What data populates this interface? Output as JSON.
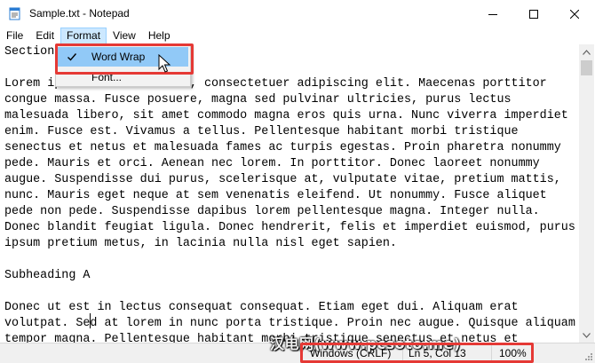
{
  "window": {
    "title": "Sample.txt - Notepad"
  },
  "menubar": {
    "items": [
      {
        "label": "File"
      },
      {
        "label": "Edit"
      },
      {
        "label": "Format",
        "active": true
      },
      {
        "label": "View"
      },
      {
        "label": "Help"
      }
    ]
  },
  "format_menu": {
    "items": [
      {
        "label": "Word Wrap",
        "checked": true
      },
      {
        "label": "Font..."
      }
    ]
  },
  "editor": {
    "lines": [
      "Section",
      "",
      "Lorem ipsum dolor sit amet, consectetuer adipiscing elit. Maecenas porttitor",
      "congue massa. Fusce posuere, magna sed pulvinar ultricies, purus lectus",
      "malesuada libero, sit amet commodo magna eros quis urna. Nunc viverra imperdiet",
      "enim. Fusce est. Vivamus a tellus. Pellentesque habitant morbi tristique",
      "senectus et netus et malesuada fames ac turpis egestas. Proin pharetra nonummy",
      "pede. Mauris et orci. Aenean nec lorem. In porttitor. Donec laoreet nonummy",
      "augue. Suspendisse dui purus, scelerisque at, vulputate vitae, pretium mattis,",
      "nunc. Mauris eget neque at sem venenatis eleifend. Ut nonummy. Fusce aliquet",
      "pede non pede. Suspendisse dapibus lorem pellentesque magna. Integer nulla.",
      "Donec blandit feugiat ligula. Donec hendrerit, felis et imperdiet euismod, purus",
      "ipsum pretium metus, in lacinia nulla nisl eget sapien.",
      "",
      "Subheading A",
      "",
      "Donec ut est in lectus consequat consequat. Etiam eget dui. Aliquam erat",
      "volutpat. Sed at lorem in nunc porta tristique. Proin nec augue. Quisque aliquam",
      "tempor magna. Pellentesque habitant morbi tristique senectus et netus et"
    ]
  },
  "statusbar": {
    "line_ending": "Windows (CRLF)",
    "position": "Ln 5, Col 13",
    "zoom": "100%"
  },
  "watermark": {
    "text": "汉电网(www.pcsoto.me)"
  },
  "colors": {
    "menu_active_bg": "#cce8ff",
    "dropdown_hover_bg": "#91c9f7",
    "highlight_red": "#e53935"
  }
}
